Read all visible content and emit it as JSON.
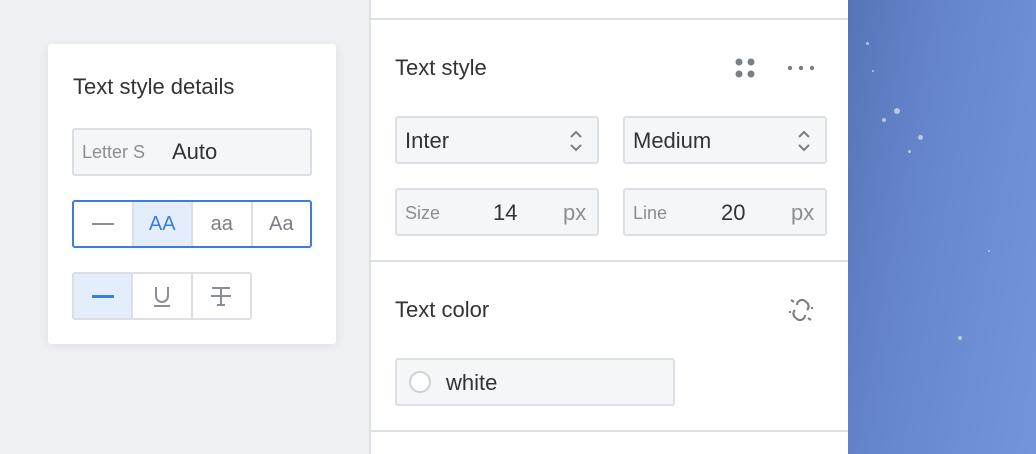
{
  "popover": {
    "title": "Text style details",
    "letter_spacing": {
      "label": "Letter S",
      "value": "Auto"
    },
    "case_options": [
      {
        "name": "case-none-button",
        "label": "",
        "icon": "dash-icon",
        "active": false
      },
      {
        "name": "case-uppercase-button",
        "label": "AA",
        "active": true
      },
      {
        "name": "case-lowercase-button",
        "label": "aa",
        "active": false
      },
      {
        "name": "case-titlecase-button",
        "label": "Aa",
        "active": false
      }
    ],
    "decoration_options": [
      {
        "name": "decoration-none-button",
        "icon": "dash-icon",
        "active": true
      },
      {
        "name": "decoration-underline-button",
        "icon": "underline-icon",
        "active": false
      },
      {
        "name": "decoration-strikethrough-button",
        "icon": "strikethrough-icon",
        "active": false
      }
    ]
  },
  "text_style": {
    "title": "Text style",
    "font_family": "Inter",
    "font_weight": "Medium",
    "size": {
      "label": "Size",
      "value": "14",
      "unit": "px"
    },
    "line": {
      "label": "Line",
      "value": "20",
      "unit": "px"
    },
    "icons": [
      "grid-dots-icon",
      "more-horizontal-icon"
    ]
  },
  "text_color": {
    "title": "Text color",
    "value": "white",
    "swatch_color": "#ffffff",
    "icon": "detach-style-icon"
  },
  "colors": {
    "accent": "#3b7ddd",
    "active_bg": "#e3edfb",
    "border": "#dcdfe4",
    "field_bg": "#f5f6f8"
  }
}
